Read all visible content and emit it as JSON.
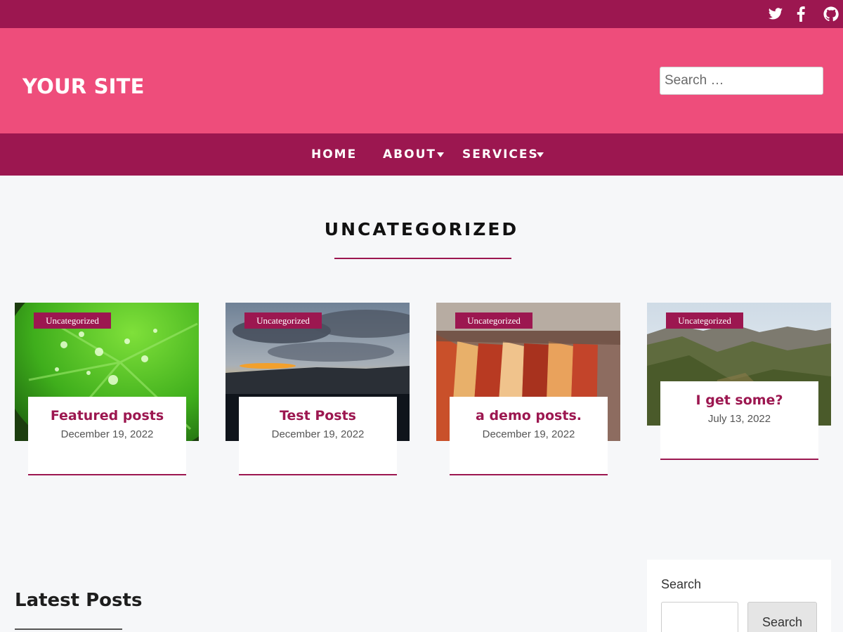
{
  "topbar": {
    "social_icons": [
      "twitter-icon",
      "facebook-icon",
      "github-icon"
    ]
  },
  "header": {
    "site_title": "YOUR SITE",
    "search_placeholder": "Search …"
  },
  "nav": {
    "items": [
      {
        "label": "HOME",
        "has_submenu": false
      },
      {
        "label": "ABOUT",
        "has_submenu": true
      },
      {
        "label": "SERVICES",
        "has_submenu": true
      }
    ]
  },
  "section": {
    "title": "UNCATEGORIZED"
  },
  "posts": [
    {
      "category": "Uncategorized",
      "title": "Featured posts",
      "date": "December 19, 2022",
      "image": "green-leaf-with-water-drops"
    },
    {
      "category": "Uncategorized",
      "title": "Test Posts",
      "date": "December 19, 2022",
      "image": "sunset-over-water"
    },
    {
      "category": "Uncategorized",
      "title": "a demo posts.",
      "date": "December 19, 2022",
      "image": "grilled-ribs-closeup"
    },
    {
      "category": "Uncategorized",
      "title": "I get some?",
      "date": "July 13, 2022",
      "image": "mountain-valley"
    }
  ],
  "latest": {
    "title": "Latest Posts"
  },
  "sidebar": {
    "search_label": "Search",
    "search_button": "Search",
    "search_value": ""
  },
  "colors": {
    "primary": "#9c1750",
    "header_pink": "#ee4d7b",
    "page_background": "#f6f7f9"
  }
}
